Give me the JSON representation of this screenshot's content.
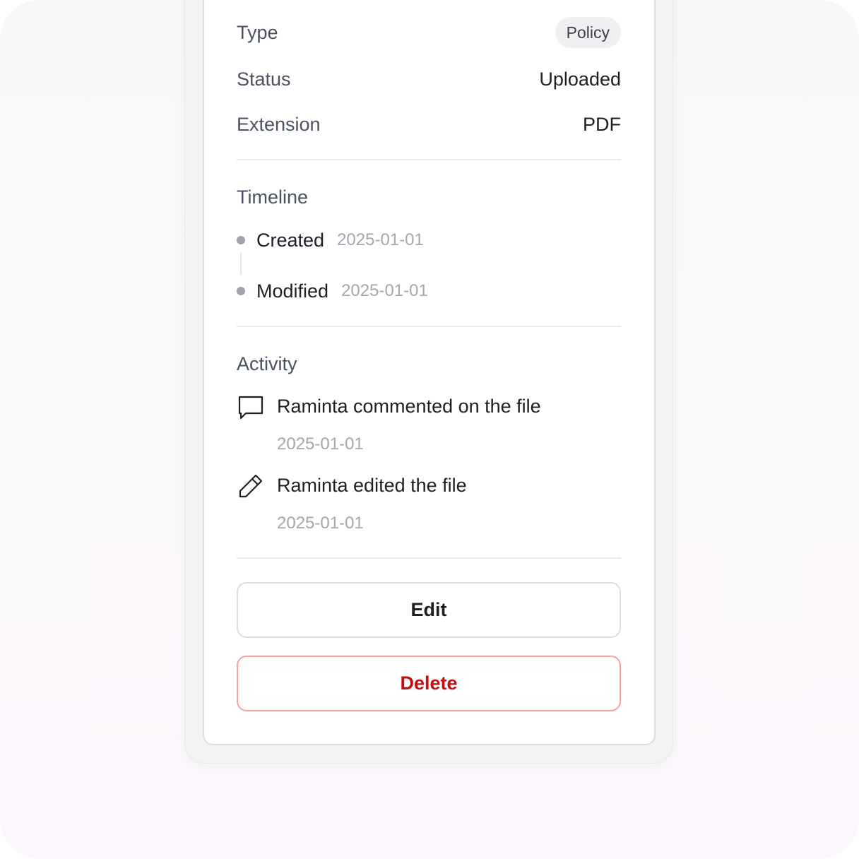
{
  "details": {
    "type_label": "Type",
    "type_value": "Policy",
    "status_label": "Status",
    "status_value": "Uploaded",
    "extension_label": "Extension",
    "extension_value": "PDF"
  },
  "timeline": {
    "title": "Timeline",
    "items": [
      {
        "label": "Created",
        "date": "2025-01-01"
      },
      {
        "label": "Modified",
        "date": "2025-01-01"
      }
    ]
  },
  "activity": {
    "title": "Activity",
    "items": [
      {
        "icon": "comment-icon",
        "text": "Raminta commented on the file",
        "date": "2025-01-01"
      },
      {
        "icon": "pencil-icon",
        "text": "Raminta edited the file",
        "date": "2025-01-01"
      }
    ]
  },
  "actions": {
    "edit_label": "Edit",
    "delete_label": "Delete"
  },
  "colors": {
    "delete_text": "#c20d0d",
    "delete_border": "#f3a39b",
    "muted_text": "#a4a7b0"
  }
}
